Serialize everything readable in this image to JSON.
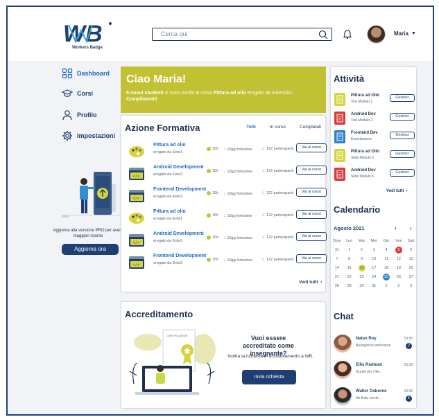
{
  "header": {
    "logo_text": "WB",
    "logo_sub": "Workers Badge",
    "search_placeholder": "Cerca qui",
    "user_name": "Maria"
  },
  "sidebar": {
    "items": [
      {
        "label": "Dashboard",
        "icon": "dashboard-icon"
      },
      {
        "label": "Corsi",
        "icon": "graduation-cap-icon"
      },
      {
        "label": "Profilo",
        "icon": "user-icon"
      },
      {
        "label": "Impostazioni",
        "icon": "gear-icon"
      }
    ],
    "promo_text": "Aggiorna alla versione PRO per avere maggiori risorse",
    "promo_button": "Aggiorna ora"
  },
  "welcome": {
    "title": "Ciao Maria!",
    "msg_a": "5 nuovi studenti",
    "msg_b": " si sono iscritti al corso ",
    "msg_c": "Pittura ad olio",
    "msg_d": " erogato da Azienda1. ",
    "msg_e": "Complimenti!"
  },
  "azione": {
    "title": "Azione Formativa",
    "tabs": [
      "Tutti",
      "In corso",
      "Completati"
    ],
    "rows": [
      {
        "title": "Pittura ad olio",
        "sub": "erogato da Ente1",
        "hours": "15h",
        "days": "10gg formative",
        "participants": "122 partecipanti",
        "button": "Vai al corso",
        "thumb": "palette"
      },
      {
        "title": "Android Development",
        "sub": "erogato da Ente2",
        "hours": "15h",
        "days": "10gg formative",
        "participants": "122 partecipanti",
        "button": "Vai al corso",
        "thumb": "code"
      },
      {
        "title": "Frontend Development",
        "sub": "erogato da Ente3",
        "hours": "15h",
        "days": "10gg formative",
        "participants": "122 partecipanti",
        "button": "Vai al corso",
        "thumb": "code"
      },
      {
        "title": "Pittura ad olio",
        "sub": "erogato da Ente1",
        "hours": "15h",
        "days": "10gg formative",
        "participants": "122 partecipanti",
        "button": "Vai al corso",
        "thumb": "palette"
      },
      {
        "title": "Android Development",
        "sub": "erogato da Ente2",
        "hours": "15h",
        "days": "10gg formative",
        "participants": "122 partecipanti",
        "button": "Vai al corso",
        "thumb": "code"
      },
      {
        "title": "Frontend Development",
        "sub": "erogato da Ente3",
        "hours": "15h",
        "days": "10gg formative",
        "participants": "122 partecipanti",
        "button": "Vai al corso",
        "thumb": "code"
      }
    ],
    "see_all": "Vedi tutti"
  },
  "accreditamento": {
    "title": "Accreditamento",
    "question": "Vuoi essere accreditato come insegnante?",
    "desc": "Inoltra la richiesta di accreditamento a WB.",
    "button": "Invia richiesta",
    "illustration_label": "CERTIFICATION"
  },
  "attivita": {
    "title": "Attività",
    "items": [
      {
        "title": "Pittura ad Olio",
        "sub": "Test Modulo 1",
        "button": "Gestisci",
        "color": "#d6d43a"
      },
      {
        "title": "Android Dev",
        "sub": "Test Modulo 2",
        "button": "Gestisci",
        "color": "#d93a3a"
      },
      {
        "title": "Frontend Dev",
        "sub": "Esercitazione",
        "button": "Gestisci",
        "color": "#2f7fd1"
      },
      {
        "title": "Pittura ad Olio",
        "sub": "Slide Modulo 5",
        "button": "Gestisci",
        "color": "#d6d43a"
      },
      {
        "title": "Android Dev",
        "sub": "Slide Modulo 5",
        "button": "Gestisci",
        "color": "#d93a3a"
      }
    ],
    "see_all": "Vedi tutti"
  },
  "calendario": {
    "title": "Calendario",
    "month": "Agosto 2021",
    "days": [
      "Dom",
      "Lun",
      "Mar",
      "Mer",
      "Gio",
      "Ven",
      "Sab"
    ],
    "weeks": [
      [
        "31",
        "1",
        "2",
        "3",
        "4",
        "5",
        "6"
      ],
      [
        "7",
        "8",
        "9",
        "10",
        "11",
        "12",
        "13"
      ],
      [
        "14",
        "15",
        "16",
        "17",
        "18",
        "19",
        "20"
      ],
      [
        "21",
        "22",
        "23",
        "24",
        "25",
        "26",
        "27"
      ],
      [
        "28",
        "29",
        "30",
        "31",
        "1",
        "2",
        "3"
      ]
    ]
  },
  "chat": {
    "title": "Chat",
    "items": [
      {
        "name": "Natan Roy",
        "msg": "Buongiorno professore",
        "time": "10:30",
        "badge": "2"
      },
      {
        "name": "Ellis Rodman",
        "msg": "Grazie per i file...",
        "time": "10:30",
        "badge": ""
      },
      {
        "name": "Walter Osborne",
        "msg": "Ho finito ora di...",
        "time": "10:30",
        "badge": "5"
      }
    ]
  },
  "colors": {
    "primary": "#1d3f73",
    "accent_yellow": "#c2c133",
    "link_blue": "#1c67d2"
  }
}
